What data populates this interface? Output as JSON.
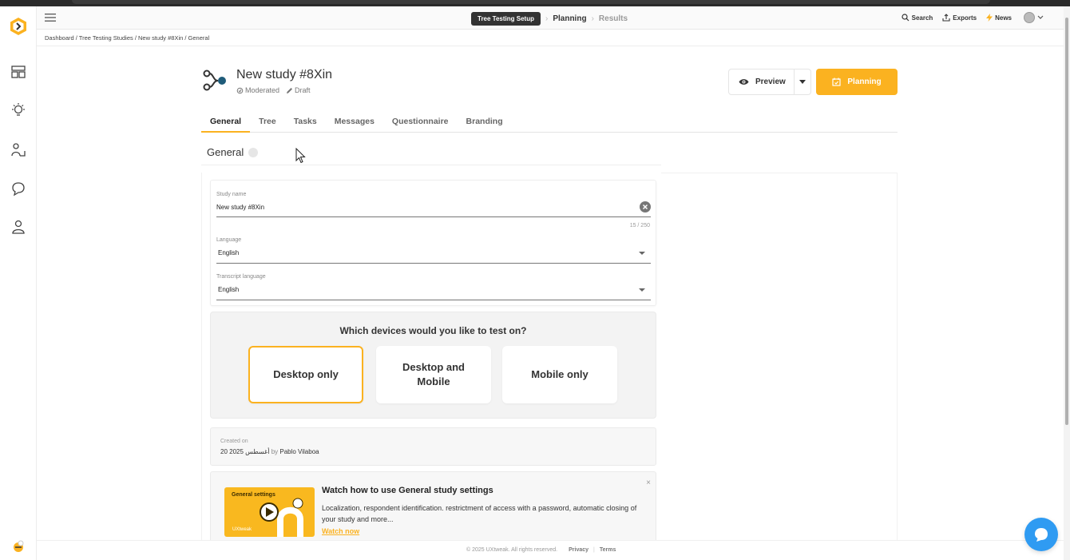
{
  "topbar": {
    "steps": {
      "setup": "Tree Testing Setup",
      "planning": "Planning",
      "results": "Results"
    },
    "search_label": "Search",
    "exports_label": "Exports",
    "news_label": "News"
  },
  "breadcrumb": "Dashboard / Tree Testing Studies / New study #8Xin / General",
  "study": {
    "title": "New study #8Xin",
    "mode": "Moderated",
    "status": "Draft"
  },
  "actions": {
    "preview_label": "Preview",
    "planning_label": "Planning"
  },
  "tabs": [
    {
      "label": "General"
    },
    {
      "label": "Tree"
    },
    {
      "label": "Tasks"
    },
    {
      "label": "Messages"
    },
    {
      "label": "Questionnaire"
    },
    {
      "label": "Branding"
    }
  ],
  "section_title": "General",
  "form": {
    "study_name": {
      "label": "Study name",
      "value": "New study #8Xin",
      "counter": "15 / 250"
    },
    "language": {
      "label": "Language",
      "value": "English"
    },
    "transcript_language": {
      "label": "Transcript language",
      "value": "English"
    }
  },
  "devices": {
    "question": "Which devices would you like to test on?",
    "options": [
      {
        "label": "Desktop only",
        "selected": true
      },
      {
        "label": "Desktop and Mobile",
        "selected": false
      },
      {
        "label": "Mobile only",
        "selected": false
      }
    ]
  },
  "created": {
    "label": "Created on",
    "date": "20 أغسطس 2025",
    "by": "by",
    "author": "Pablo Vilaboa"
  },
  "video": {
    "thumb_title": "General settings",
    "thumb_brand": "UXtweak",
    "title": "Watch how to use General study settings",
    "description": "Localization, respondent identification. restrictment of access with a password, automatic closing of your study and more...",
    "link": "Watch now",
    "close": "×"
  },
  "footer": {
    "copyright": "© 2025 UXtweak. All rights reserved.",
    "privacy": "Privacy",
    "separator": "|",
    "terms": "Terms"
  },
  "colors": {
    "accent": "#fbb220",
    "chat": "#2f9bf2",
    "pill": "#333333"
  }
}
